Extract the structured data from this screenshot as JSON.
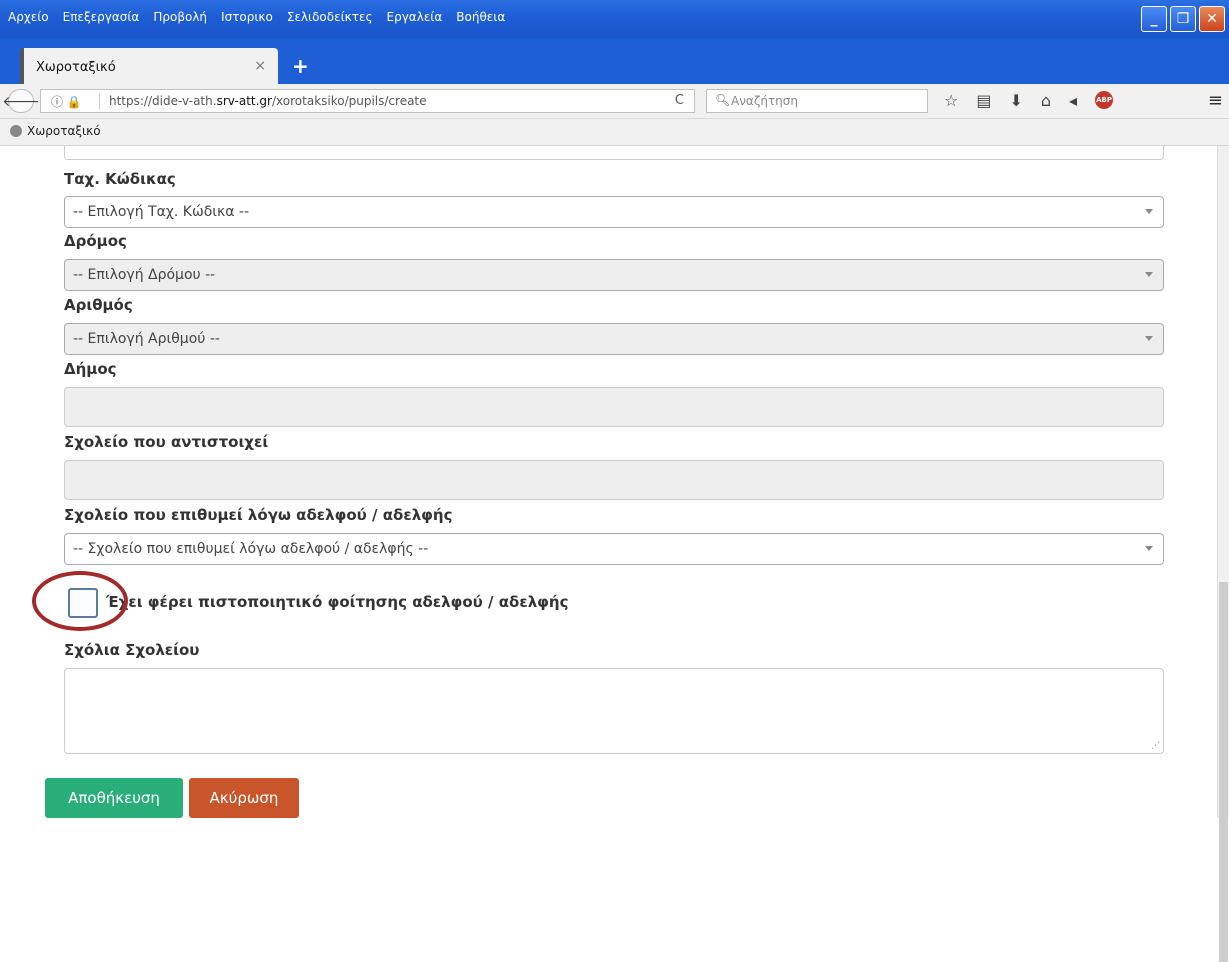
{
  "menu": {
    "items": [
      "Αρχείο",
      "Επεξεργασία",
      "Προβολή",
      "Ιστορικο",
      "Σελιδοδείκτες",
      "Εργαλεία",
      "Βοήθεια"
    ]
  },
  "tab": {
    "title": "Χωροταξικό",
    "close": "×",
    "new": "+"
  },
  "nav": {
    "url_prefix": "https://dide-v-ath.",
    "url_domain": "srv-att.gr",
    "url_path": "/xorotaksiko/pupils/create",
    "search_placeholder": "Αναζήτηση"
  },
  "bookmarks": {
    "item": "Χωροταξικό"
  },
  "form": {
    "postal_code_label": "Ταχ. Κώδικας",
    "postal_code_value": "-- Επιλογή Ταχ. Κώδικα --",
    "street_label": "Δρόμος",
    "street_value": "-- Επιλογή Δρόμου --",
    "number_label": "Αριθμός",
    "number_value": "-- Επιλογή Αριθμού --",
    "municipality_label": "Δήμος",
    "school_label": "Σχολείο που αντιστοιχεί",
    "sibling_school_label": "Σχολείο που επιθυμεί λόγω αδελφού / αδελφής",
    "sibling_school_value": "-- Σχολείο που επιθυμεί λόγω αδελφού / αδελφής --",
    "certificate_checkbox_label": "Έχει φέρει πιστοποιητικό φοίτησης αδελφού / αδελφής",
    "certificate_checked": false,
    "comments_label": "Σχόλια Σχολείου"
  },
  "buttons": {
    "save": "Αποθήκευση",
    "cancel": "Ακύρωση"
  },
  "colors": {
    "save": "#2aae79",
    "cancel": "#c9552b",
    "highlight": "#a32a2a",
    "titlebar": "#1f5fd6"
  }
}
